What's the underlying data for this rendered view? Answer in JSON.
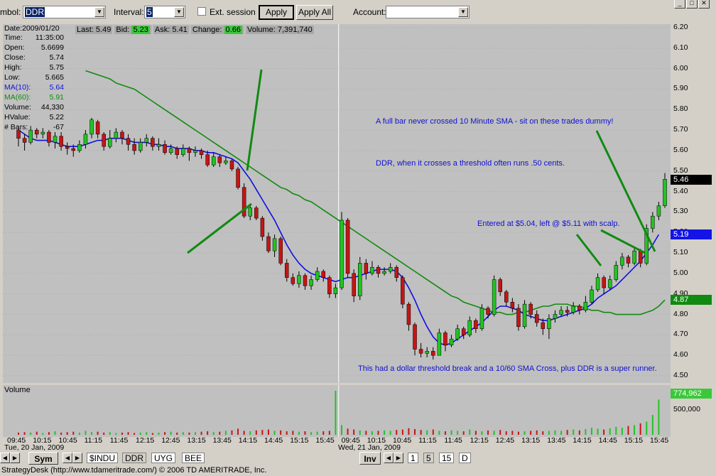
{
  "toolbar": {
    "symbol_label": "mbol:",
    "symbol_value": "DDR",
    "interval_label": "Interval:",
    "interval_value": "5",
    "ext_session_label": "Ext. session",
    "apply_label": "Apply",
    "apply_all_label": "Apply All",
    "account_label": "Account:",
    "account_value": ""
  },
  "quote": {
    "last_label": "Last:",
    "last": "5.49",
    "bid_label": "Bid:",
    "bid": "5.23",
    "ask_label": "Ask:",
    "ask": "5.41",
    "change_label": "Change:",
    "change": "0.66",
    "volume_label": "Volume:",
    "volume": "7,391,740"
  },
  "info_panel": [
    {
      "label": "Date:2009/01/20",
      "value": ""
    },
    {
      "label": "Time:",
      "value": "11:35:00"
    },
    {
      "label": "Open:",
      "value": "5.6699"
    },
    {
      "label": "Close:",
      "value": "5.74"
    },
    {
      "label": "High:",
      "value": "5.75"
    },
    {
      "label": "Low:",
      "value": "5.665"
    },
    {
      "label": "MA(10):",
      "value": "5.64"
    },
    {
      "label": "MA(60):",
      "value": "5.91"
    },
    {
      "label": "Volume:",
      "value": "44,330"
    },
    {
      "label": "HValue:",
      "value": "5.22"
    },
    {
      "label": "# Bars:",
      "value": "-67"
    }
  ],
  "annotations": {
    "note1": "A full bar never crossed 10 Minute SMA - sit on these trades dummy!",
    "note2": "DDR, when it crosses a threshold often runs .50 cents.",
    "note3": "Entered at $5.04, left @ $5.11 with scalp.",
    "note4": "This had a dollar threshold break and a 10/60 SMA Cross, plus DDR is a super runner."
  },
  "price_axis": [
    "6.20",
    "6.10",
    "6.00",
    "5.90",
    "5.80",
    "5.70",
    "5.60",
    "5.50",
    "5.40",
    "5.30",
    "5.20",
    "5.10",
    "5.00",
    "4.90",
    "4.80",
    "4.70",
    "4.60",
    "4.50"
  ],
  "price_tags": {
    "last": "5.46",
    "bid": "5.19",
    "ma60": "4.87"
  },
  "volume_panel": {
    "title": "Volume",
    "tag": "774,962",
    "axis_label": "500,000"
  },
  "time_axis": [
    "09:45",
    "10:15",
    "10:45",
    "11:15",
    "11:45",
    "12:15",
    "12:45",
    "13:15",
    "13:45",
    "14:15",
    "14:45",
    "15:15",
    "15:45",
    "09:45",
    "10:15",
    "10:45",
    "11:15",
    "11:45",
    "12:15",
    "12:45",
    "13:15",
    "13:45",
    "14:15",
    "14:45",
    "15:15",
    "15:45"
  ],
  "date_labels": {
    "day1": "Tue, 20 Jan, 2009",
    "day2": "Wed, 21 Jan, 2009"
  },
  "tabs": {
    "sym_label": "Sym",
    "symbols": [
      "$INDU",
      "DDR",
      "UYG",
      "BEE"
    ],
    "inv_label": "Inv",
    "intervals": [
      "1",
      "5",
      "15",
      "D"
    ]
  },
  "status": "StrategyDesk (http://www.tdameritrade.com/) © 2006 TD AMERITRADE, Inc.",
  "colors": {
    "up": "#22c322",
    "down": "#c81414",
    "ma10": "#1010e0",
    "ma60": "#108a10",
    "trendline": "#108a10",
    "bid_tag": "#1414e6",
    "ma60_tag": "#108a10"
  },
  "chart_data": {
    "type": "candlestick",
    "ylim": [
      4.5,
      6.2
    ],
    "candles": [
      [
        5.7,
        5.66,
        5.72,
        5.62
      ],
      [
        5.66,
        5.64,
        5.68,
        5.6
      ],
      [
        5.64,
        5.7,
        5.72,
        5.63
      ],
      [
        5.7,
        5.68,
        5.71,
        5.66
      ],
      [
        5.68,
        5.69,
        5.71,
        5.66
      ],
      [
        5.69,
        5.64,
        5.7,
        5.62
      ],
      [
        5.64,
        5.67,
        5.69,
        5.61
      ],
      [
        5.67,
        5.62,
        5.69,
        5.6
      ],
      [
        5.62,
        5.61,
        5.64,
        5.58
      ],
      [
        5.61,
        5.6,
        5.63,
        5.57
      ],
      [
        5.6,
        5.63,
        5.65,
        5.59
      ],
      [
        5.63,
        5.68,
        5.7,
        5.61
      ],
      [
        5.68,
        5.75,
        5.76,
        5.66
      ],
      [
        5.74,
        5.68,
        5.75,
        5.66
      ],
      [
        5.68,
        5.62,
        5.69,
        5.6
      ],
      [
        5.62,
        5.66,
        5.7,
        5.61
      ],
      [
        5.66,
        5.69,
        5.71,
        5.64
      ],
      [
        5.69,
        5.66,
        5.7,
        5.63
      ],
      [
        5.66,
        5.63,
        5.68,
        5.6
      ],
      [
        5.63,
        5.6,
        5.66,
        5.58
      ],
      [
        5.6,
        5.64,
        5.66,
        5.59
      ],
      [
        5.64,
        5.66,
        5.68,
        5.62
      ],
      [
        5.66,
        5.62,
        5.67,
        5.6
      ],
      [
        5.62,
        5.63,
        5.66,
        5.6
      ],
      [
        5.63,
        5.59,
        5.65,
        5.58
      ],
      [
        5.59,
        5.61,
        5.63,
        5.58
      ],
      [
        5.61,
        5.58,
        5.62,
        5.56
      ],
      [
        5.58,
        5.61,
        5.63,
        5.57
      ],
      [
        5.61,
        5.59,
        5.62,
        5.55
      ],
      [
        5.59,
        5.6,
        5.62,
        5.57
      ],
      [
        5.6,
        5.58,
        5.61,
        5.56
      ],
      [
        5.58,
        5.53,
        5.6,
        5.52
      ],
      [
        5.53,
        5.57,
        5.59,
        5.52
      ],
      [
        5.57,
        5.54,
        5.58,
        5.52
      ],
      [
        5.54,
        5.55,
        5.57,
        5.53
      ],
      [
        5.55,
        5.51,
        5.56,
        5.5
      ],
      [
        5.51,
        5.42,
        5.52,
        5.41
      ],
      [
        5.42,
        5.28,
        5.44,
        5.27
      ],
      [
        5.28,
        5.32,
        5.34,
        5.26
      ],
      [
        5.32,
        5.27,
        5.33,
        5.26
      ],
      [
        5.27,
        5.18,
        5.28,
        5.16
      ],
      [
        5.18,
        5.11,
        5.2,
        5.1
      ],
      [
        5.11,
        5.17,
        5.19,
        5.08
      ],
      [
        5.17,
        5.05,
        5.18,
        5.04
      ],
      [
        5.05,
        4.98,
        5.07,
        4.96
      ],
      [
        4.98,
        4.95,
        5.0,
        4.94
      ],
      [
        4.95,
        4.99,
        5.01,
        4.93
      ],
      [
        4.99,
        4.94,
        5.0,
        4.92
      ],
      [
        4.94,
        4.97,
        4.99,
        4.92
      ],
      [
        4.97,
        5.01,
        5.03,
        4.96
      ],
      [
        5.01,
        4.98,
        5.02,
        4.96
      ],
      [
        4.98,
        4.9,
        4.99,
        4.88
      ],
      [
        4.9,
        4.93,
        4.95,
        4.88
      ],
      [
        4.93,
        5.26,
        5.3,
        4.92
      ],
      [
        5.26,
        5.0,
        5.27,
        4.98
      ],
      [
        5.0,
        4.89,
        5.02,
        4.86
      ],
      [
        4.89,
        5.05,
        5.08,
        4.87
      ],
      [
        5.05,
        5.0,
        5.07,
        4.97
      ],
      [
        5.0,
        5.03,
        5.06,
        4.99
      ],
      [
        5.03,
        5.0,
        5.04,
        4.98
      ],
      [
        5.0,
        5.01,
        5.03,
        4.99
      ],
      [
        5.01,
        5.03,
        5.05,
        5.0
      ],
      [
        5.03,
        4.98,
        5.04,
        4.96
      ],
      [
        4.98,
        4.85,
        4.99,
        4.83
      ],
      [
        4.85,
        4.75,
        4.86,
        4.72
      ],
      [
        4.75,
        4.63,
        4.76,
        4.6
      ],
      [
        4.63,
        4.61,
        4.66,
        4.59
      ],
      [
        4.61,
        4.62,
        4.64,
        4.59
      ],
      [
        4.62,
        4.6,
        4.64,
        4.58
      ],
      [
        4.6,
        4.71,
        4.73,
        4.6
      ],
      [
        4.71,
        4.65,
        4.72,
        4.62
      ],
      [
        4.65,
        4.68,
        4.7,
        4.64
      ],
      [
        4.68,
        4.73,
        4.75,
        4.67
      ],
      [
        4.73,
        4.7,
        4.74,
        4.68
      ],
      [
        4.7,
        4.77,
        4.79,
        4.69
      ],
      [
        4.77,
        4.73,
        4.78,
        4.71
      ],
      [
        4.73,
        4.83,
        4.85,
        4.72
      ],
      [
        4.83,
        4.8,
        4.84,
        4.78
      ],
      [
        4.8,
        4.97,
        4.99,
        4.79
      ],
      [
        4.97,
        4.91,
        4.98,
        4.89
      ],
      [
        4.91,
        4.86,
        4.92,
        4.84
      ],
      [
        4.86,
        4.83,
        4.88,
        4.81
      ],
      [
        4.83,
        4.74,
        4.85,
        4.72
      ],
      [
        4.74,
        4.85,
        4.87,
        4.73
      ],
      [
        4.85,
        4.8,
        4.86,
        4.78
      ],
      [
        4.8,
        4.76,
        4.82,
        4.74
      ],
      [
        4.76,
        4.73,
        4.78,
        4.7
      ],
      [
        4.73,
        4.78,
        4.8,
        4.68
      ],
      [
        4.78,
        4.8,
        4.82,
        4.76
      ],
      [
        4.8,
        4.82,
        4.84,
        4.79
      ],
      [
        4.82,
        4.81,
        4.84,
        4.79
      ],
      [
        4.81,
        4.84,
        4.86,
        4.8
      ],
      [
        4.84,
        4.82,
        4.85,
        4.8
      ],
      [
        4.82,
        4.86,
        4.89,
        4.81
      ],
      [
        4.86,
        4.92,
        4.94,
        4.85
      ],
      [
        4.92,
        4.98,
        5.0,
        4.91
      ],
      [
        4.98,
        4.93,
        4.99,
        4.9
      ],
      [
        4.93,
        4.97,
        4.99,
        4.92
      ],
      [
        4.97,
        5.04,
        5.06,
        4.96
      ],
      [
        5.04,
        5.08,
        5.1,
        5.02
      ],
      [
        5.08,
        5.05,
        5.09,
        5.03
      ],
      [
        5.05,
        5.11,
        5.13,
        5.04
      ],
      [
        5.11,
        5.05,
        5.12,
        5.03
      ],
      [
        5.05,
        5.22,
        5.24,
        5.04
      ],
      [
        5.22,
        5.28,
        5.3,
        5.2
      ],
      [
        5.28,
        5.33,
        5.35,
        5.26
      ],
      [
        5.33,
        5.46,
        5.49,
        5.32
      ]
    ],
    "ma10": [
      5.7,
      5.68,
      5.66,
      5.65,
      5.65,
      5.65,
      5.64,
      5.63,
      5.62,
      5.62,
      5.62,
      5.63,
      5.64,
      5.65,
      5.65,
      5.66,
      5.66,
      5.66,
      5.65,
      5.64,
      5.64,
      5.64,
      5.63,
      5.63,
      5.62,
      5.62,
      5.61,
      5.61,
      5.61,
      5.6,
      5.6,
      5.59,
      5.59,
      5.58,
      5.57,
      5.56,
      5.54,
      5.5,
      5.46,
      5.41,
      5.36,
      5.31,
      5.26,
      5.2,
      5.14,
      5.09,
      5.05,
      5.02,
      5.0,
      4.99,
      4.98,
      4.97,
      4.96,
      4.97,
      4.98,
      4.98,
      4.99,
      5.0,
      5.01,
      5.02,
      5.02,
      5.02,
      5.01,
      4.98,
      4.93,
      4.87,
      4.8,
      4.74,
      4.69,
      4.66,
      4.65,
      4.66,
      4.68,
      4.7,
      4.72,
      4.74,
      4.76,
      4.79,
      4.82,
      4.84,
      4.84,
      4.83,
      4.82,
      4.8,
      4.79,
      4.78,
      4.77,
      4.77,
      4.78,
      4.79,
      4.8,
      4.81,
      4.82,
      4.83,
      4.85,
      4.88,
      4.9,
      4.92,
      4.94,
      4.97,
      5.0,
      5.03,
      5.06,
      5.1,
      5.14,
      5.19
    ],
    "ma60": [
      5.99,
      5.98,
      5.97,
      5.96,
      5.95,
      5.93,
      5.92,
      5.91,
      5.9,
      5.88,
      5.86,
      5.84,
      5.82,
      5.8,
      5.78,
      5.76,
      5.74,
      5.72,
      5.7,
      5.68,
      5.66,
      5.64,
      5.62,
      5.6,
      5.58,
      5.56,
      5.54,
      5.52,
      5.5,
      5.48,
      5.46,
      5.44,
      5.42,
      5.41,
      5.39,
      5.38,
      5.36,
      5.35,
      5.33,
      5.31,
      5.29,
      5.27,
      5.25,
      5.23,
      5.21,
      5.19,
      5.17,
      5.15,
      5.13,
      5.11,
      5.09,
      5.07,
      5.05,
      5.03,
      5.01,
      4.99,
      4.97,
      4.95,
      4.93,
      4.91,
      4.89,
      4.88,
      4.86,
      4.85,
      4.84,
      4.83,
      4.82,
      4.81,
      4.81,
      4.8,
      4.8,
      4.81,
      4.81,
      4.82,
      4.83,
      4.84,
      4.84,
      4.85,
      4.85,
      4.85,
      4.84,
      4.84,
      4.83,
      4.82,
      4.82,
      4.81,
      4.81,
      4.8,
      4.8,
      4.8,
      4.8,
      4.8,
      4.81,
      4.82,
      4.84,
      4.87
    ],
    "volume": [
      0.05,
      0.06,
      0.05,
      0.07,
      0.04,
      0.06,
      0.08,
      0.05,
      0.06,
      0.07,
      0.05,
      0.09,
      0.06,
      0.07,
      0.05,
      0.06,
      0.04,
      0.05,
      0.06,
      0.04,
      0.05,
      0.06,
      0.04,
      0.05,
      0.06,
      0.07,
      0.05,
      0.06,
      0.05,
      0.06,
      0.07,
      0.08,
      0.06,
      0.07,
      0.09,
      0.1,
      0.14,
      0.09,
      0.08,
      0.1,
      0.11,
      0.12,
      0.09,
      0.1,
      0.08,
      0.09,
      0.07,
      0.08,
      0.06,
      0.07,
      0.08,
      0.09,
      1.0,
      0.22,
      0.14,
      0.12,
      0.1,
      0.09,
      0.08,
      0.09,
      0.1,
      0.09,
      0.11,
      0.12,
      0.15,
      0.13,
      0.11,
      0.1,
      0.12,
      0.09,
      0.08,
      0.1,
      0.09,
      0.08,
      0.12,
      0.09,
      0.08,
      0.1,
      0.09,
      0.11,
      0.08,
      0.09,
      0.07,
      0.08,
      0.09,
      0.1,
      0.08,
      0.09,
      0.1,
      0.09,
      0.11,
      0.12,
      0.1,
      0.13,
      0.16,
      0.14,
      0.12,
      0.15,
      0.18,
      0.16,
      0.2,
      0.22,
      0.26,
      0.3,
      0.45,
      0.8
    ]
  }
}
